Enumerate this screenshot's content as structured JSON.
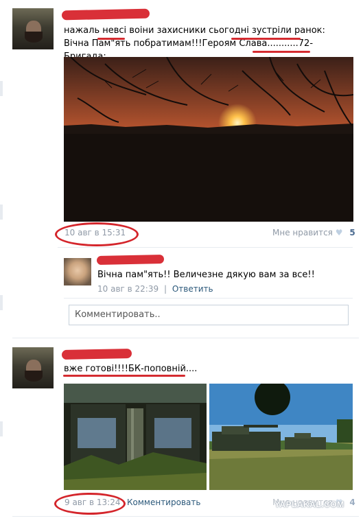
{
  "posts": [
    {
      "text": "нажаль невсі воіни захисники сьогодні зустріли ранок: Вічна Пам\"ять побратимам!!!Героям Слава...........72-Бригада:",
      "time": "10 авг в 15:31",
      "like_label": "Мне нравится",
      "like_count": "5",
      "reply": {
        "text": "Вічна пам\"ять!! Величезне дякую вам за все!!",
        "time": "10 авг в 22:39",
        "separator": "|",
        "action": "Ответить"
      },
      "comment_placeholder": "Комментировать.."
    },
    {
      "text": "вже готові!!!!БК-поповній....",
      "time": "9 авг в 13:24",
      "comment_link": "Комментировать",
      "like_label": "Мне нравится",
      "like_count": "4"
    }
  ],
  "watermark": "YAPLAKAL.COM",
  "colors": {
    "link": "#2b587a",
    "meta": "#8f99a6",
    "annotation": "#d42b30"
  }
}
